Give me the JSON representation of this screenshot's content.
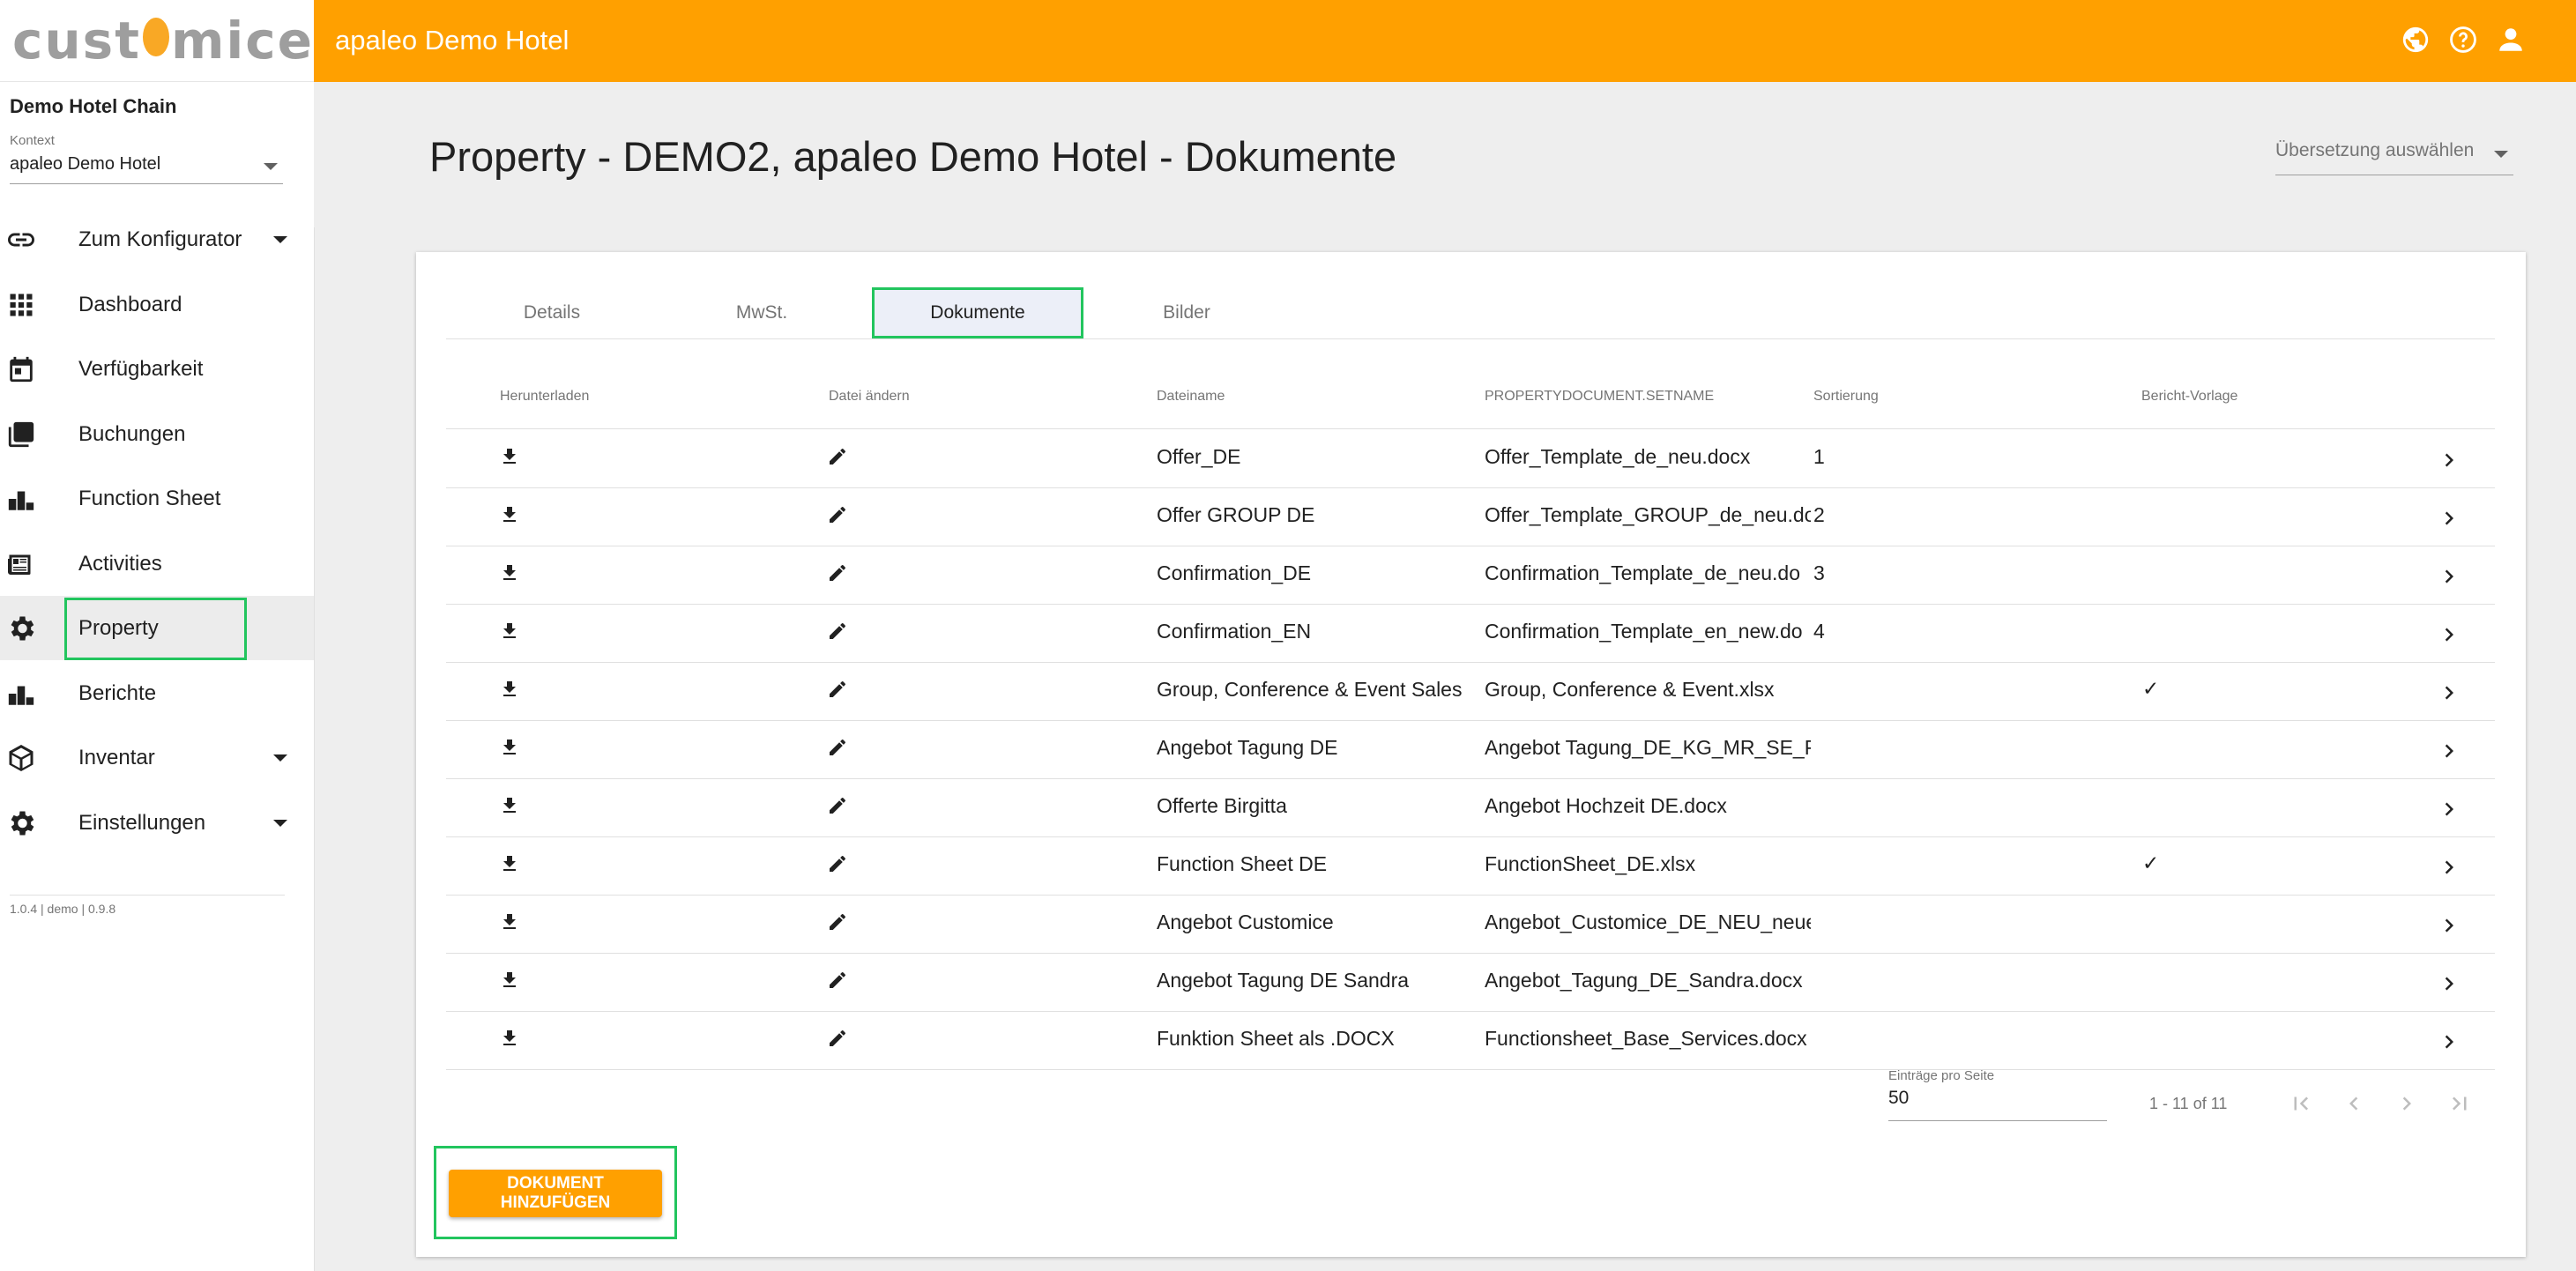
{
  "app": {
    "logo_text_left": "cust",
    "logo_text_right": "mice",
    "title": "apaleo Demo Hotel"
  },
  "sidebar": {
    "chain": "Demo Hotel Chain",
    "context_label": "Kontext",
    "context_value": "apaleo Demo Hotel",
    "items": [
      {
        "label": "Zum Konfigurator",
        "icon": "link-icon"
      },
      {
        "label": "Dashboard",
        "icon": "grid-icon"
      },
      {
        "label": "Verfügbarkeit",
        "icon": "calendar-icon"
      },
      {
        "label": "Buchungen",
        "icon": "layers-icon"
      },
      {
        "label": "Function Sheet",
        "icon": "bar-chart-icon"
      },
      {
        "label": "Activities",
        "icon": "newspaper-icon"
      },
      {
        "label": "Property",
        "icon": "gear-icon"
      },
      {
        "label": "Berichte",
        "icon": "bar-chart-icon"
      },
      {
        "label": "Inventar",
        "icon": "cube-icon"
      },
      {
        "label": "Einstellungen",
        "icon": "gear-icon"
      }
    ],
    "version": "1.0.4 | demo | 0.9.8"
  },
  "page": {
    "title": "Property - DEMO2, apaleo Demo Hotel - Dokumente",
    "translate_placeholder": "Übersetzung auswählen"
  },
  "tabs": [
    "Details",
    "MwSt.",
    "Dokumente",
    "Bilder"
  ],
  "table": {
    "headers": [
      "Herunterladen",
      "Datei ändern",
      "Dateiname",
      "PROPERTYDOCUMENT.SETNAME",
      "Sortierung",
      "Bericht-Vorlage"
    ],
    "rows": [
      {
        "name": "Offer_DE",
        "file": "Offer_Template_de_neu.docx",
        "sort": "1",
        "report": ""
      },
      {
        "name": "Offer GROUP DE",
        "file": "Offer_Template_GROUP_de_neu.do",
        "sort": "2",
        "report": ""
      },
      {
        "name": "Confirmation_DE",
        "file": "Confirmation_Template_de_neu.do",
        "sort": "3",
        "report": ""
      },
      {
        "name": "Confirmation_EN",
        "file": "Confirmation_Template_en_new.do",
        "sort": "4",
        "report": ""
      },
      {
        "name": "Group, Conference & Event Sales",
        "file": "Group, Conference & Event.xlsx",
        "sort": "",
        "report": "✓"
      },
      {
        "name": "Angebot Tagung DE",
        "file": "Angebot Tagung_DE_KG_MR_SE_PI",
        "sort": "",
        "report": ""
      },
      {
        "name": "Offerte Birgitta",
        "file": "Angebot Hochzeit DE.docx",
        "sort": "",
        "report": ""
      },
      {
        "name": "Function Sheet DE",
        "file": "FunctionSheet_DE.xlsx",
        "sort": "",
        "report": "✓"
      },
      {
        "name": "Angebot Customice",
        "file": "Angebot_Customice_DE_NEU_neue",
        "sort": "",
        "report": ""
      },
      {
        "name": "Angebot Tagung DE Sandra",
        "file": "Angebot_Tagung_DE_Sandra.docx",
        "sort": "",
        "report": ""
      },
      {
        "name": "Funktion Sheet als .DOCX",
        "file": "Functionsheet_Base_Services.docx",
        "sort": "",
        "report": ""
      }
    ]
  },
  "pager": {
    "label": "Einträge pro Seite",
    "per_page": "50",
    "range": "1 - 11 of 11"
  },
  "actions": {
    "add_document": "DOKUMENT HINZUFÜGEN"
  },
  "colors": {
    "accent": "#ffa000",
    "highlight": "#22c55e"
  }
}
